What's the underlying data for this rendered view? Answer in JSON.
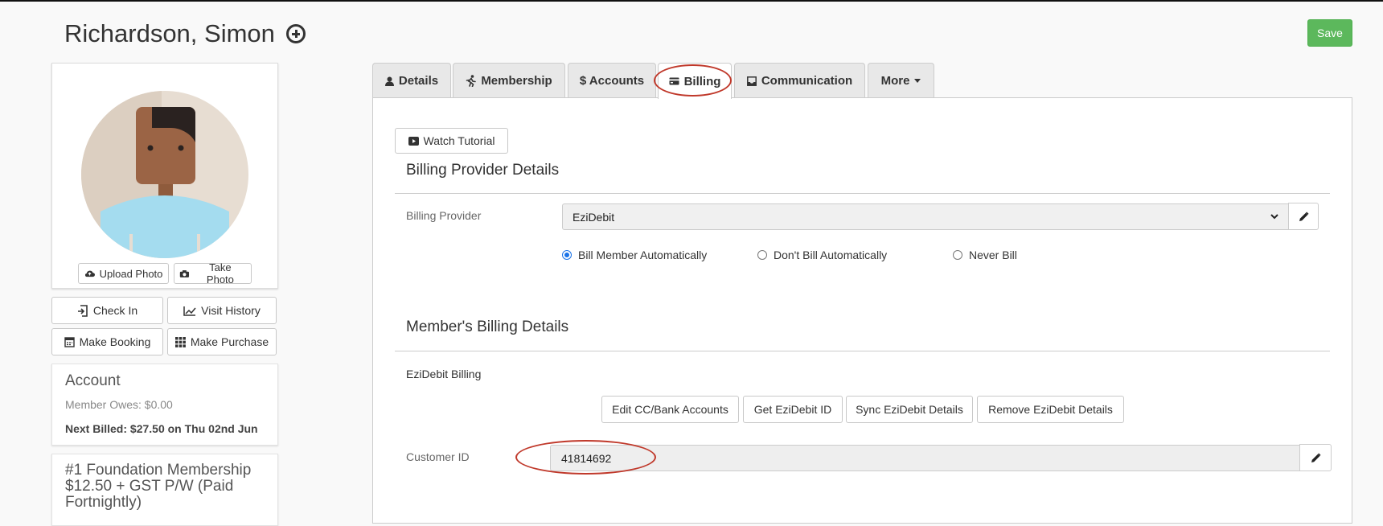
{
  "member": {
    "name": "Richardson, Simon"
  },
  "actions": {
    "save": "Save"
  },
  "photo": {
    "upload": "Upload Photo",
    "take": "Take Photo"
  },
  "quick": {
    "check_in": "Check In",
    "visit_history": "Visit History",
    "make_booking": "Make Booking",
    "make_purchase": "Make Purchase"
  },
  "account": {
    "title": "Account",
    "owes": "Member Owes: $0.00",
    "next_billed": "Next Billed: $27.50 on Thu 02nd Jun"
  },
  "membership": {
    "title": "#1 Foundation Membership $12.50 + GST P/W (Paid Fortnightly)"
  },
  "tabs": [
    {
      "label": "Details"
    },
    {
      "label": "Membership"
    },
    {
      "label": "$ Accounts"
    },
    {
      "label": "Billing"
    },
    {
      "label": "Communication"
    },
    {
      "label": "More"
    }
  ],
  "billing": {
    "tutorial": "Watch Tutorial",
    "provider_section": "Billing Provider Details",
    "provider_label": "Billing Provider",
    "provider_value": "EziDebit",
    "radio_auto": "Bill Member Automatically",
    "radio_dont": "Don't Bill Automatically",
    "radio_never": "Never Bill",
    "member_section": "Member's Billing Details",
    "ezidebit_billing": "EziDebit Billing",
    "btn_edit_cc": "Edit CC/Bank Accounts",
    "btn_get_id": "Get EziDebit ID",
    "btn_sync": "Sync EziDebit Details",
    "btn_remove": "Remove EziDebit Details",
    "customer_id_label": "Customer ID",
    "customer_id_value": "41814692"
  },
  "colors": {
    "save_green": "#5cb85c",
    "annotation_red": "#c0392b",
    "radio_blue": "#1a73e8"
  }
}
